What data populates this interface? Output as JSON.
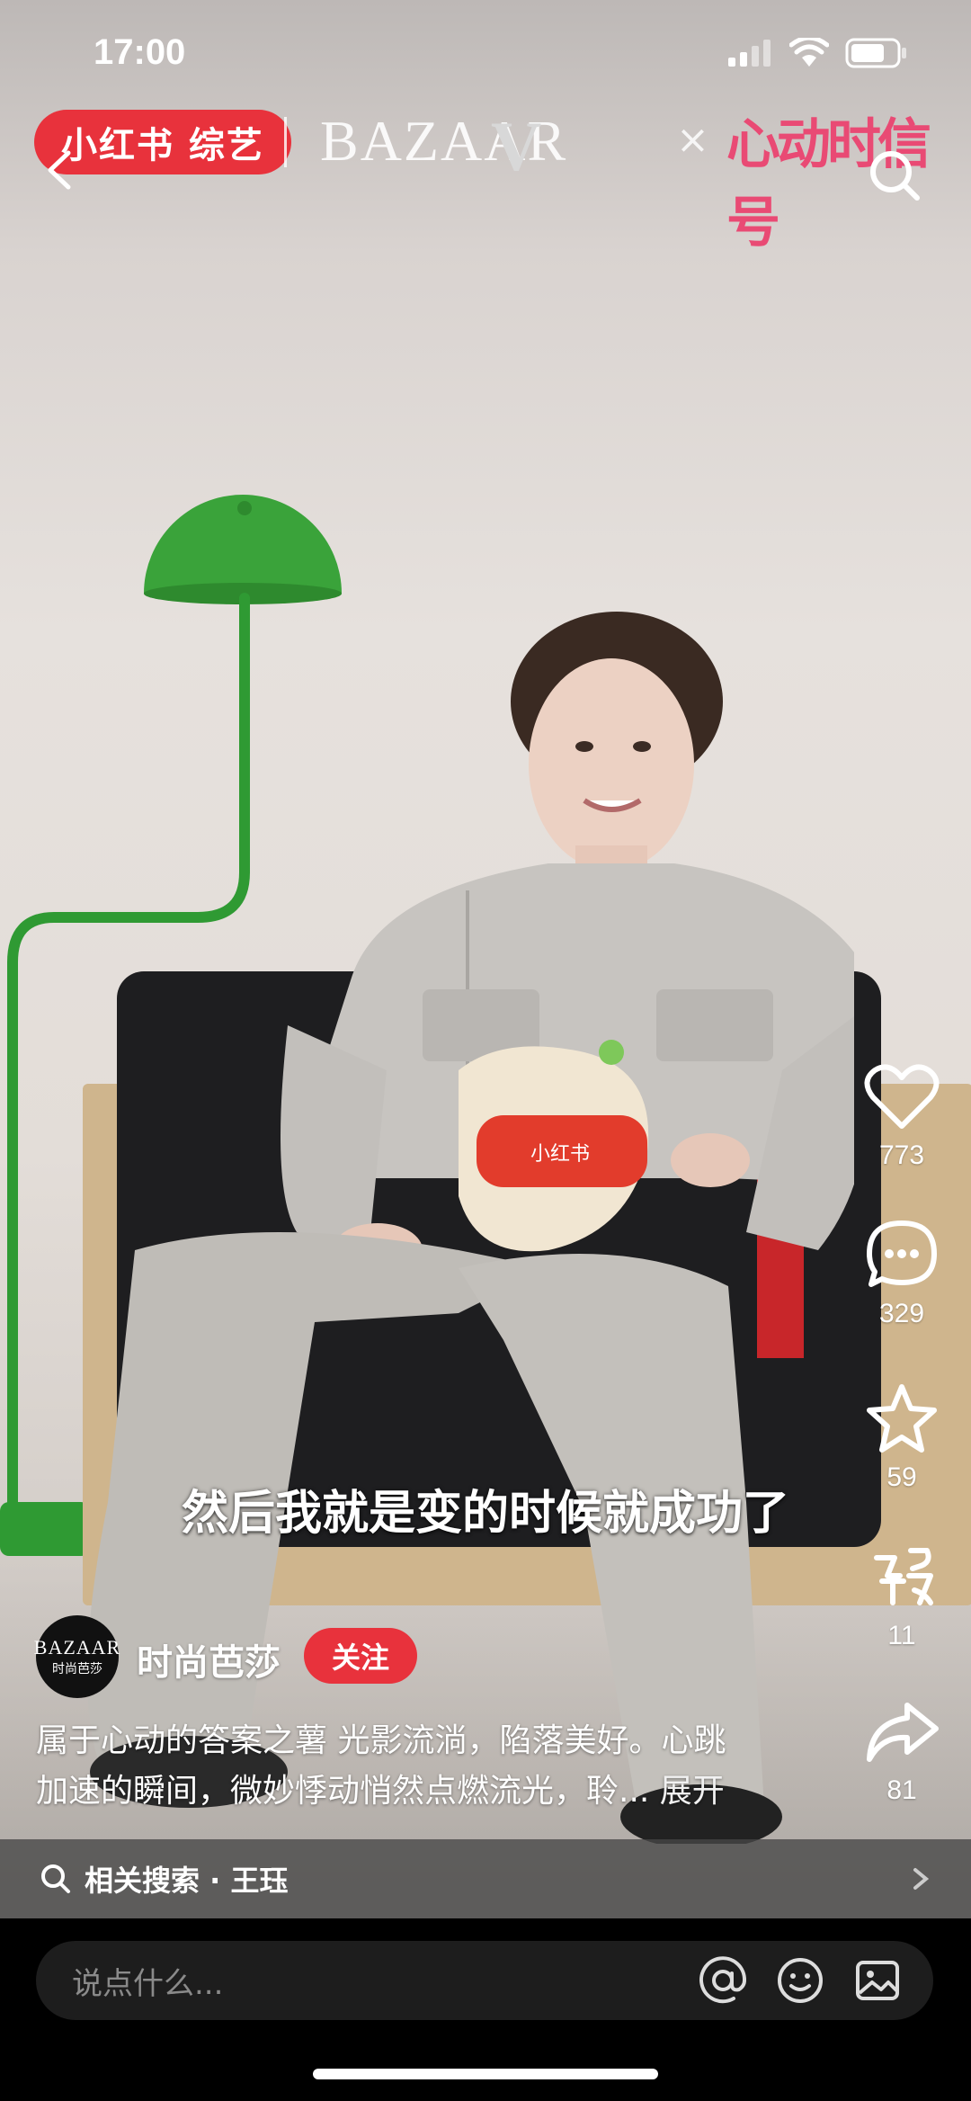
{
  "status": {
    "time": "17:00"
  },
  "header": {
    "brand": "小红书 综艺",
    "partner": "BAZAAR",
    "partner_mark": "V",
    "times": "×",
    "show": "心动时信号"
  },
  "actions": {
    "like_count": "773",
    "comment_count": "329",
    "collect_count": "59",
    "share_alt_count": "11",
    "share_count": "81"
  },
  "subtitle": "然后我就是变的时候就成功了",
  "author": {
    "avatar_text_1": "BAZAAR",
    "avatar_text_2": "时尚芭莎",
    "name": "时尚芭莎",
    "follow_label": "关注"
  },
  "description": {
    "line1": "属于心动的答案之薯 光影流淌，陷落美好。心跳",
    "line2": "加速的瞬间，微妙悸动悄然点燃流光，聆...",
    "more": "展开"
  },
  "related": {
    "label": "相关搜索 · 王珏"
  },
  "comment": {
    "placeholder": "说点什么..."
  },
  "toy_label": "小红书"
}
